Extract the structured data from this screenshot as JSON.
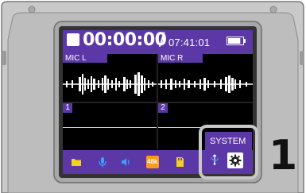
{
  "device": {
    "name": ""
  },
  "status": {
    "elapsed_time": "00:00:00",
    "separator": "/",
    "remaining_time": "07:41:01",
    "battery_level_fraction": 0.85
  },
  "tracks": {
    "left_label": "MIC L",
    "right_label": "MIC R",
    "track1_num": "1",
    "track2_num": "2"
  },
  "bottom_bar": {
    "icons": [
      "folder-icon",
      "microphone-icon",
      "speaker-icon",
      "sample-rate-icon",
      "sd-card-icon",
      "usb-icon",
      "gear-icon"
    ],
    "sample_rate_badge": "48k"
  },
  "system": {
    "label": "SYSTEM"
  },
  "callout": {
    "number": "1"
  },
  "colors": {
    "accent": "#5c38a6",
    "screen_bg": "#000000",
    "device_gray": "#b5b5b5",
    "icon_yellow": "#f4d21a",
    "icon_blue": "#3aa0ff",
    "icon_orange": "#ff9a1a",
    "icon_white": "#ffffff"
  }
}
